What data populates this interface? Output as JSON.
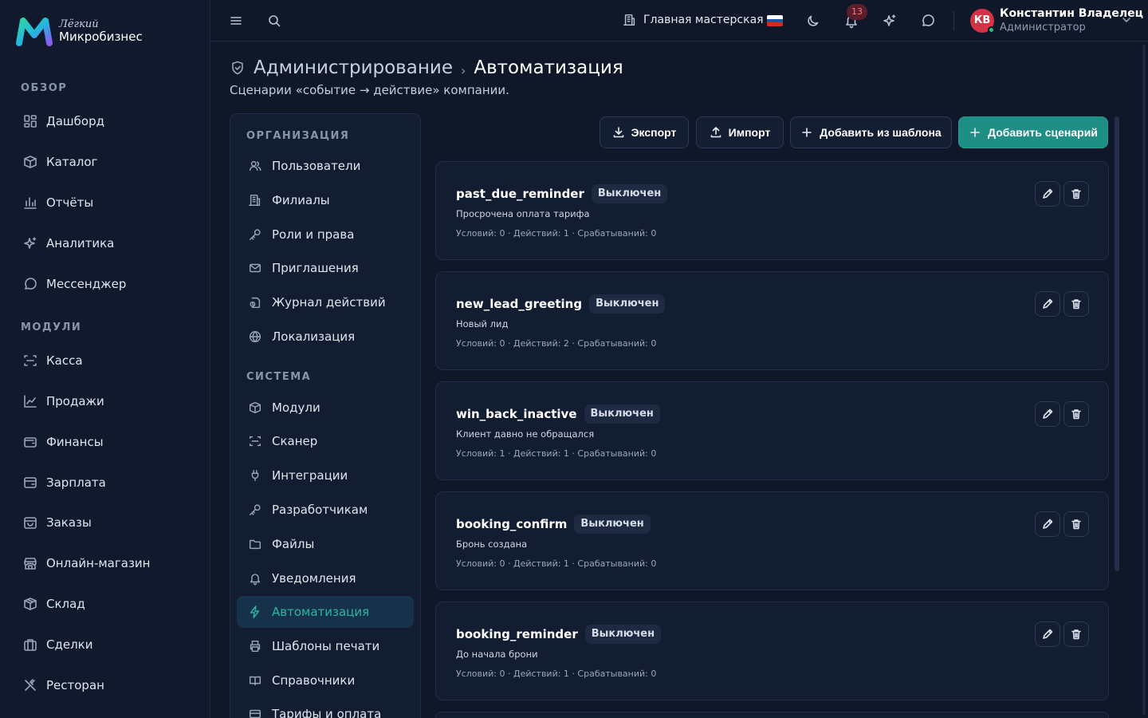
{
  "brand": {
    "script": "Лёгкий",
    "name": "Микробизнес"
  },
  "sidebar": {
    "sections": [
      "ОБЗОР",
      "МОДУЛИ"
    ],
    "items": [
      {
        "label": "Дашборд",
        "icon": "dashboard-icon"
      },
      {
        "label": "Каталог",
        "icon": "catalog-icon"
      },
      {
        "label": "Отчёты",
        "icon": "reports-icon"
      },
      {
        "label": "Аналитика",
        "icon": "analytics-icon"
      },
      {
        "label": "Мессенджер",
        "icon": "messenger-icon"
      },
      {
        "label": "Касса",
        "icon": "cashier-icon"
      },
      {
        "label": "Продажи",
        "icon": "sales-icon"
      },
      {
        "label": "Финансы",
        "icon": "finance-icon"
      },
      {
        "label": "Зарплата",
        "icon": "salary-icon"
      },
      {
        "label": "Заказы",
        "icon": "orders-icon"
      },
      {
        "label": "Онлайн-магазин",
        "icon": "store-icon"
      },
      {
        "label": "Склад",
        "icon": "warehouse-icon"
      },
      {
        "label": "Сделки",
        "icon": "deals-icon"
      },
      {
        "label": "Ресторан",
        "icon": "restaurant-icon"
      }
    ]
  },
  "topbar": {
    "branch": "Главная мастерская",
    "notifications_count": "13",
    "user_initials": "КВ",
    "user_name": "Константин Владелец",
    "user_role": "Администратор",
    "flag_colors": [
      "#ffffff",
      "#1c57a5",
      "#d52b1e"
    ]
  },
  "page": {
    "breadcrumb_root": "Администрирование",
    "breadcrumb_sep": "›",
    "title": "Автоматизация",
    "subtitle": "Сценарии «событие → действие» компании."
  },
  "admin_nav": {
    "section_org": "ОРГАНИЗАЦИЯ",
    "section_system": "СИСТЕМА",
    "org_items": [
      {
        "label": "Пользователи",
        "icon": "users-icon"
      },
      {
        "label": "Филиалы",
        "icon": "branches-icon"
      },
      {
        "label": "Роли и права",
        "icon": "key-icon"
      },
      {
        "label": "Приглашения",
        "icon": "mail-icon"
      },
      {
        "label": "Журнал действий",
        "icon": "audit-log-icon"
      },
      {
        "label": "Локализация",
        "icon": "globe-icon"
      }
    ],
    "system_items": [
      {
        "label": "Модули",
        "icon": "modules-icon"
      },
      {
        "label": "Сканер",
        "icon": "scanner-icon"
      },
      {
        "label": "Интеграции",
        "icon": "plug-icon"
      },
      {
        "label": "Разработчикам",
        "icon": "developer-key-icon"
      },
      {
        "label": "Файлы",
        "icon": "folder-icon"
      },
      {
        "label": "Уведомления",
        "icon": "bell-icon"
      },
      {
        "label": "Автоматизация",
        "icon": "lightning-icon",
        "active": true
      },
      {
        "label": "Шаблоны печати",
        "icon": "printer-icon"
      },
      {
        "label": "Справочники",
        "icon": "book-icon"
      },
      {
        "label": "Тарифы и оплата",
        "icon": "card-icon"
      }
    ],
    "active_color": "#2bb5a6"
  },
  "actions": {
    "export": "Экспорт",
    "import": "Импорт",
    "from_template": "Добавить из шаблона",
    "add": "Добавить сценарий",
    "accent": "#1f8f86"
  },
  "scenarios": [
    {
      "name": "past_due_reminder",
      "status": "Выключен",
      "description": "Просрочена оплата тарифа",
      "meta": "Условий: 0 · Действий: 1 · Срабатываний: 0"
    },
    {
      "name": "new_lead_greeting",
      "status": "Выключен",
      "description": "Новый лид",
      "meta": "Условий: 0 · Действий: 2 · Срабатываний: 0"
    },
    {
      "name": "win_back_inactive",
      "status": "Выключен",
      "description": "Клиент давно не обращался",
      "meta": "Условий: 1 · Действий: 1 · Срабатываний: 0"
    },
    {
      "name": "booking_confirm",
      "status": "Выключен",
      "description": "Бронь создана",
      "meta": "Условий: 0 · Действий: 1 · Срабатываний: 0"
    },
    {
      "name": "booking_reminder",
      "status": "Выключен",
      "description": "До начала брони",
      "meta": "Условий: 0 · Действий: 1 · Срабатываний: 0"
    }
  ]
}
